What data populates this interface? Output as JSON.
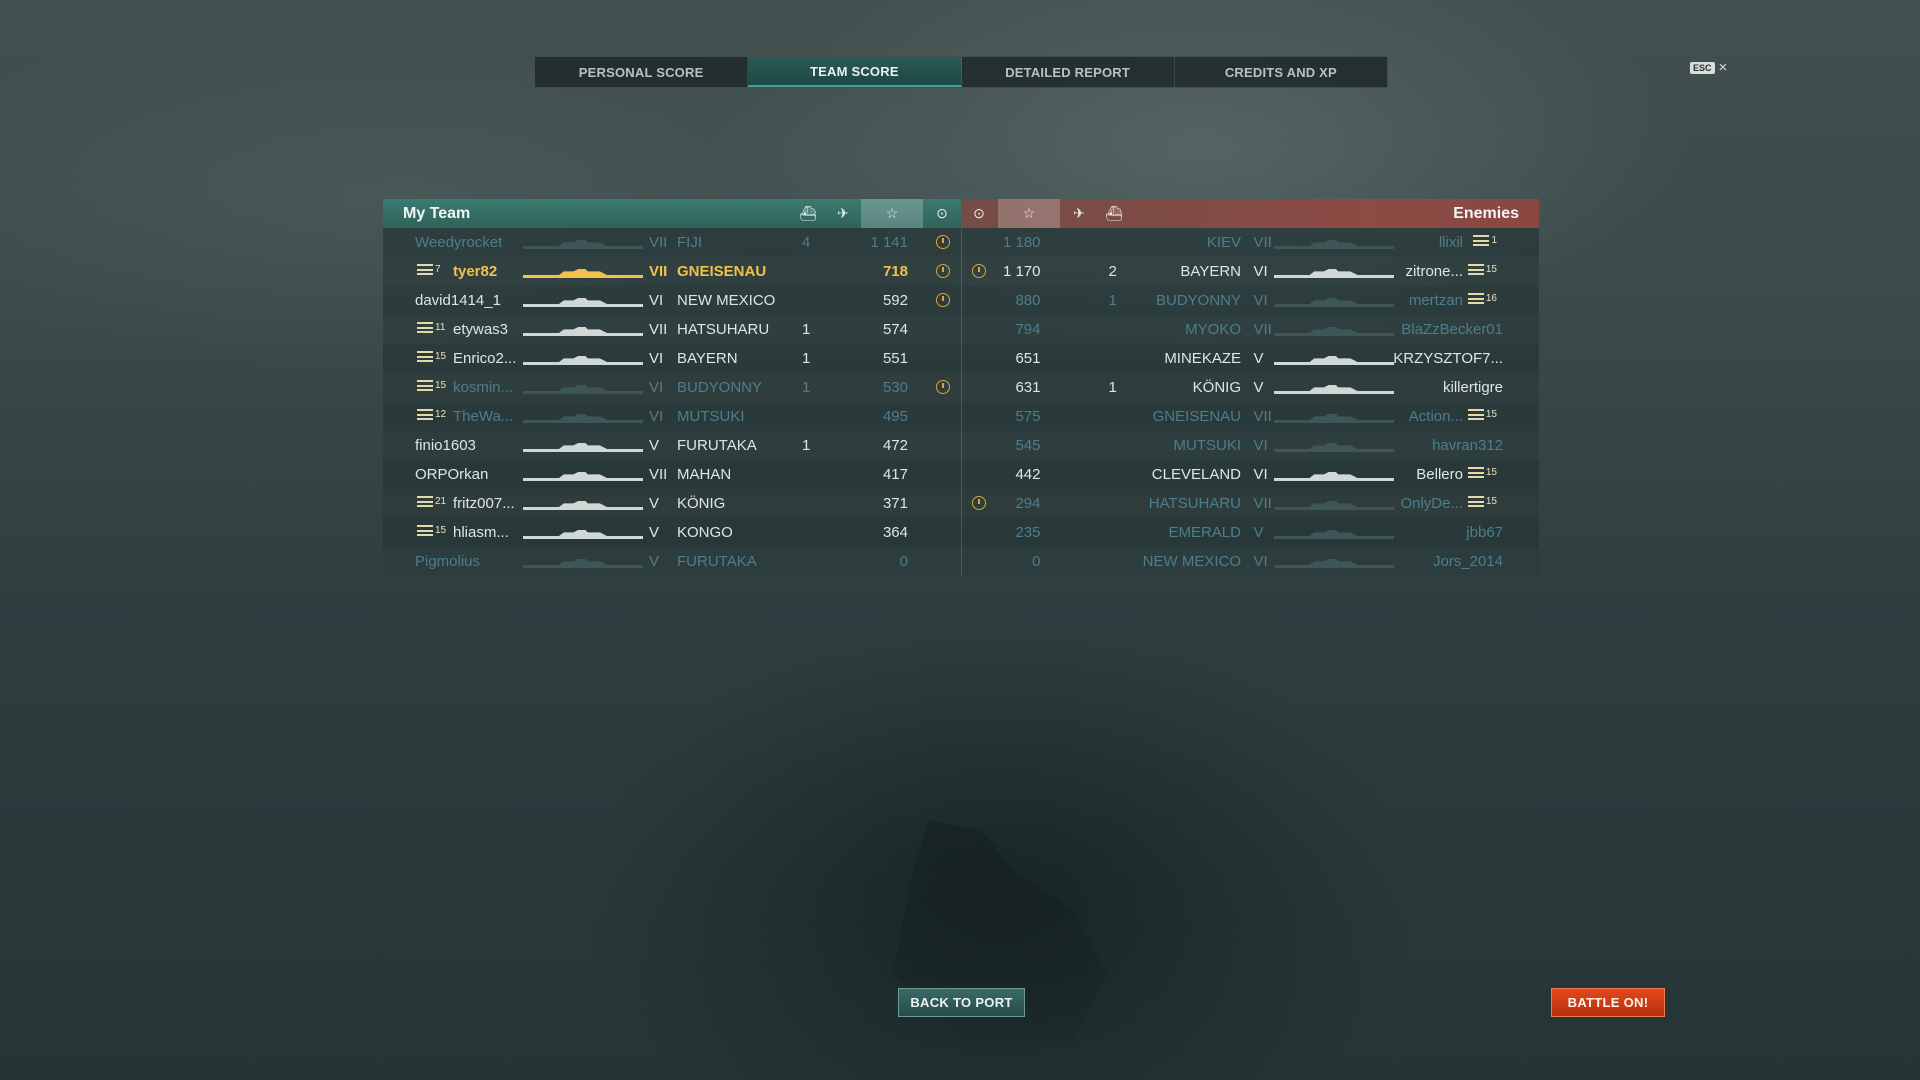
{
  "tabs": [
    "PERSONAL SCORE",
    "TEAM SCORE",
    "DETAILED REPORT",
    "CREDITS AND XP"
  ],
  "active_tab": 1,
  "esc": {
    "key": "ESC",
    "close": "×"
  },
  "my_team": {
    "title": "My Team",
    "rows": [
      {
        "name": "Weedyrocket",
        "rank": "",
        "tier": "VII",
        "ship": "FIJI",
        "kills": "4",
        "score": "1 141",
        "cap": true,
        "state": "dead"
      },
      {
        "name": "tyer82",
        "rank": "7",
        "tier": "VII",
        "ship": "GNEISENAU",
        "kills": "",
        "score": "718",
        "cap": true,
        "state": "me"
      },
      {
        "name": "david1414_1",
        "rank": "",
        "tier": "VI",
        "ship": "NEW MEXICO",
        "kills": "",
        "score": "592",
        "cap": true,
        "state": "live"
      },
      {
        "name": "etywas3",
        "rank": "11",
        "tier": "VII",
        "ship": "HATSUHARU",
        "kills": "1",
        "score": "574",
        "cap": false,
        "state": "live"
      },
      {
        "name": "Enrico2...",
        "rank": "15",
        "tier": "VI",
        "ship": "BAYERN",
        "kills": "1",
        "score": "551",
        "cap": false,
        "state": "live"
      },
      {
        "name": "kosmin...",
        "rank": "15",
        "tier": "VI",
        "ship": "BUDYONNY",
        "kills": "1",
        "score": "530",
        "cap": true,
        "state": "dead"
      },
      {
        "name": "TheWa...",
        "rank": "12",
        "tier": "VI",
        "ship": "MUTSUKI",
        "kills": "",
        "score": "495",
        "cap": false,
        "state": "dead"
      },
      {
        "name": "finio1603",
        "rank": "",
        "tier": "V",
        "ship": "FURUTAKA",
        "kills": "1",
        "score": "472",
        "cap": false,
        "state": "live"
      },
      {
        "name": "ORPOrkan",
        "rank": "",
        "tier": "VII",
        "ship": "MAHAN",
        "kills": "",
        "score": "417",
        "cap": false,
        "state": "live"
      },
      {
        "name": "fritz007...",
        "rank": "21",
        "tier": "V",
        "ship": "KÖNIG",
        "kills": "",
        "score": "371",
        "cap": false,
        "state": "live"
      },
      {
        "name": "hliasm...",
        "rank": "15",
        "tier": "V",
        "ship": "KONGO",
        "kills": "",
        "score": "364",
        "cap": false,
        "state": "live"
      },
      {
        "name": "Pigmolius",
        "rank": "",
        "tier": "V",
        "ship": "FURUTAKA",
        "kills": "",
        "score": "0",
        "cap": false,
        "state": "dead"
      }
    ]
  },
  "enemies": {
    "title": "Enemies",
    "rows": [
      {
        "name": "llixil",
        "rank": "1",
        "tier": "VII",
        "ship": "KIEV",
        "kills": "",
        "score": "1 180",
        "cap": false,
        "state": "dead"
      },
      {
        "name": "zitrone...",
        "rank": "15",
        "tier": "VI",
        "ship": "BAYERN",
        "kills": "2",
        "score": "1 170",
        "cap": true,
        "state": "live"
      },
      {
        "name": "mertzan",
        "rank": "16",
        "tier": "VI",
        "ship": "BUDYONNY",
        "kills": "1",
        "score": "880",
        "cap": false,
        "state": "dead"
      },
      {
        "name": "BlaZzBecker01",
        "rank": "",
        "tier": "VII",
        "ship": "MYOKO",
        "kills": "",
        "score": "794",
        "cap": false,
        "state": "dead"
      },
      {
        "name": "KRZYSZTOF7...",
        "rank": "",
        "tier": "V",
        "ship": "MINEKAZE",
        "kills": "",
        "score": "651",
        "cap": false,
        "state": "live"
      },
      {
        "name": "killertigre",
        "rank": "",
        "tier": "V",
        "ship": "KÖNIG",
        "kills": "1",
        "score": "631",
        "cap": false,
        "state": "live"
      },
      {
        "name": "Action...",
        "rank": "15",
        "tier": "VII",
        "ship": "GNEISENAU",
        "kills": "",
        "score": "575",
        "cap": false,
        "state": "dead"
      },
      {
        "name": "havran312",
        "rank": "",
        "tier": "VI",
        "ship": "MUTSUKI",
        "kills": "",
        "score": "545",
        "cap": false,
        "state": "dead"
      },
      {
        "name": "Bellero",
        "rank": "15",
        "tier": "VI",
        "ship": "CLEVELAND",
        "kills": "",
        "score": "442",
        "cap": false,
        "state": "live"
      },
      {
        "name": "OnlyDe...",
        "rank": "15",
        "tier": "VII",
        "ship": "HATSUHARU",
        "kills": "",
        "score": "294",
        "cap": true,
        "state": "dead"
      },
      {
        "name": "jbb67",
        "rank": "",
        "tier": "V",
        "ship": "EMERALD",
        "kills": "",
        "score": "235",
        "cap": false,
        "state": "dead"
      },
      {
        "name": "Jors_2014",
        "rank": "",
        "tier": "VI",
        "ship": "NEW MEXICO",
        "kills": "",
        "score": "0",
        "cap": false,
        "state": "dead"
      }
    ]
  },
  "buttons": {
    "back": "BACK TO PORT",
    "battle": "BATTLE ON!"
  },
  "colors": {
    "player_highlight": "#f0c24b",
    "dead": "#4d7e8e",
    "team_header": "#3c7a70",
    "enemy_header": "#8c4b45",
    "battle_button": "#e4471d"
  },
  "icons": {
    "ships_destroyed": "ship-icon",
    "planes_destroyed": "plane-icon",
    "score": "star-icon",
    "capture": "capture-icon"
  }
}
